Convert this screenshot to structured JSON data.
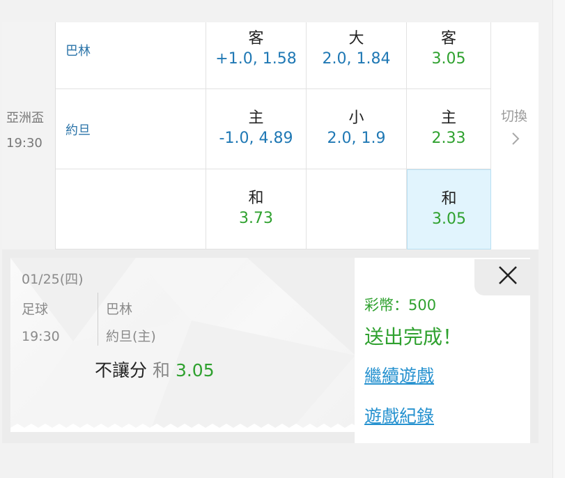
{
  "match": {
    "league": "亞洲盃",
    "time": "19:30",
    "teams": {
      "away": "巴林",
      "home": "約旦"
    },
    "handicap": {
      "away": {
        "label": "客",
        "value": "+1.0, 1.58"
      },
      "home": {
        "label": "主",
        "value": "-1.0, 4.89"
      }
    },
    "over_under": {
      "over": {
        "label": "大",
        "value": "2.0, 1.84"
      },
      "under": {
        "label": "小",
        "value": "2.0, 1.9"
      }
    },
    "moneyline": {
      "away": {
        "label": "客",
        "value": "3.05"
      },
      "home": {
        "label": "主",
        "value": "2.33"
      },
      "draw": {
        "label": "和",
        "value": "3.05"
      }
    },
    "handicap_draw": {
      "label": "和",
      "value": "3.73"
    },
    "switch_label": "切換",
    "switch_icon": "chevron-right-icon",
    "selected_cell": "moneyline-draw"
  },
  "ticket": {
    "date": "01/25(四)",
    "sport": "足球",
    "time": "19:30",
    "team1": "巴林",
    "team2": "約旦(主)",
    "bet_type": "不讓分",
    "bet_pick": "和",
    "bet_odds": "3.05"
  },
  "result": {
    "stake": "彩幣：500",
    "status": "送出完成！",
    "continue_link": "繼續遊戲",
    "history_link": "遊戲紀錄",
    "close_icon": "close-icon"
  },
  "colors": {
    "odds_green": "#2fa12f",
    "odds_blue": "#1f78b4",
    "team_blue": "#2a73a8",
    "link_blue": "#2591cf",
    "selected_bg": "#e1f4fd"
  }
}
